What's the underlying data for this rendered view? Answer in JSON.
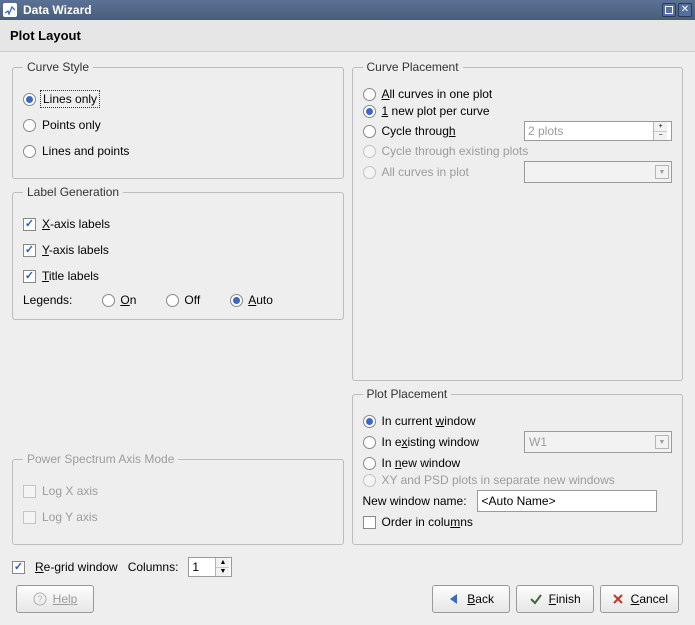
{
  "window": {
    "title": "Data Wizard"
  },
  "header": {
    "title": "Plot Layout"
  },
  "curve_style": {
    "legend": "Curve Style",
    "lines_only": "Lines only",
    "points_only": "Points only",
    "lines_and_points": "Lines and points"
  },
  "label_gen": {
    "legend": "Label Generation",
    "x_axis": "-axis labels",
    "x_prefix": "X",
    "y_axis": "-axis labels",
    "y_prefix": "Y",
    "title_labels": "itle labels",
    "title_prefix": "T",
    "legends_label": "Legends:",
    "on": "n",
    "on_prefix": "O",
    "off": "Off",
    "auto": "uto",
    "auto_prefix": "A"
  },
  "psd_axis": {
    "legend": "Power Spectrum Axis Mode",
    "log_x": "Log X axis",
    "log_y": "Log Y axis"
  },
  "curve_placement": {
    "legend": "Curve Placement",
    "all_in_one": "ll curves in one plot",
    "all_in_one_prefix": "A",
    "new_per_curve_prefix": "1",
    "new_per_curve": " new plot per curve",
    "cycle_through": "Cycle throug",
    "cycle_through_suffix": "h",
    "cycle_value": "2 plots",
    "cycle_existing": "Cycle through existing plots",
    "all_in_plot": "All curves in plot"
  },
  "plot_placement": {
    "legend": "Plot Placement",
    "in_current": "In current ",
    "in_current_suffix": "w",
    "in_current_suffix2": "indow",
    "in_existing": "In e",
    "in_existing_u": "x",
    "in_existing_suffix": "isting window",
    "existing_value": "W1",
    "in_new": "In ",
    "in_new_u": "n",
    "in_new_suffix": "ew window",
    "separate": "XY and PSD plots in separate new windows",
    "new_window_name_label": "New window name:",
    "new_window_name_value": "<Auto Name>",
    "order_cols": "Order in colu",
    "order_cols_u": "m",
    "order_cols_suffix": "ns"
  },
  "regrid": {
    "label_prefix": "R",
    "label": "e-grid window",
    "columns_label": "Columns:",
    "columns_value": "1"
  },
  "buttons": {
    "help": "Help",
    "back": "Back",
    "finish": "Finish",
    "cancel": "Cancel"
  }
}
